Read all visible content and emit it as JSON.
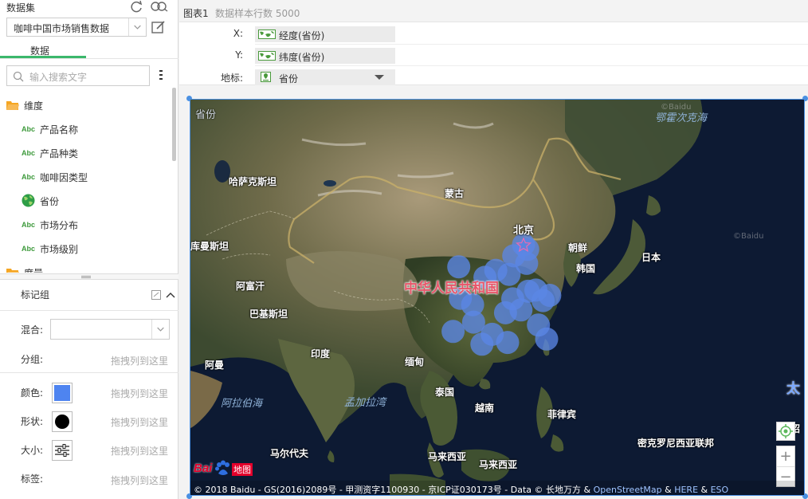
{
  "dataset": {
    "title": "数据集",
    "selected": "咖啡中国市场销售数据",
    "tab_data": "数据",
    "search_placeholder": "输入搜索文字"
  },
  "fields": {
    "dimension_group": "维度",
    "items": [
      {
        "type": "Abc",
        "label": "产品名称"
      },
      {
        "type": "Abc",
        "label": "产品种类"
      },
      {
        "type": "Abc",
        "label": "咖啡因类型"
      },
      {
        "type": "geo",
        "label": "省份"
      },
      {
        "type": "Abc",
        "label": "市场分布"
      },
      {
        "type": "Abc",
        "label": "市场级别"
      }
    ],
    "measure_group": "度量"
  },
  "marks": {
    "title": "标记组",
    "mix_label": "混合:",
    "group_label": "分组:",
    "color_label": "颜色:",
    "shape_label": "形状:",
    "size_label": "大小:",
    "tag_label": "标签:",
    "drop_hint": "拖拽列到这里",
    "color_value": "#4e84f0"
  },
  "chart": {
    "title": "图表1",
    "sample": "数据样本行数 5000",
    "x_label": "X:",
    "x_field": "经度(省份)",
    "y_label": "Y:",
    "y_field": "纬度(省份)",
    "geo_label": "地标:",
    "geo_field": "省份"
  },
  "map": {
    "corner_label": "省份",
    "labels": {
      "kazakh": "哈萨克斯坦",
      "mongolia": "蒙古",
      "beijing": "北京",
      "north_korea": "朝鲜",
      "south_korea": "韩国",
      "japan": "日本",
      "turkmen": "库曼斯坦",
      "afghan": "阿富汗",
      "pakistan": "巴基斯坦",
      "india": "印度",
      "myanmar": "缅甸",
      "oman": "阿曼",
      "thailand": "泰国",
      "vietnam": "越南",
      "philippines": "菲律宾",
      "maldives": "马尔代夫",
      "malaysia1": "马来西亚",
      "malaysia2": "马来西亚",
      "micronesia": "密克罗尼西亚联邦",
      "marshall": "马绍"
    },
    "seas": {
      "okhotsk": "鄂霍次克海",
      "arabian": "阿拉伯海",
      "bengal": "孟加拉湾"
    },
    "big_label": "中华人民共和国",
    "pacific": "太",
    "watermark": "©Baidu",
    "copyright": "© 2018 Baidu - GS(2016)2089号 - 甲测资字1100930 - 京ICP证030173号 - Data © 长地万方 & ",
    "osm": "OpenStreetMap",
    "amp1": " & ",
    "here": "HERE",
    "amp2": " & ",
    "eso": "ESO",
    "zoom_in": "+",
    "zoom_out": "−",
    "logo_text": "Bai",
    "logo_text2": "地图",
    "point_color": "#5b86e5",
    "bubbles": [
      {
        "lng": 116.4,
        "lat": 39.9
      },
      {
        "lng": 117.2,
        "lat": 39.1
      },
      {
        "lng": 114.5,
        "lat": 38.0
      },
      {
        "lng": 117.0,
        "lat": 36.7
      },
      {
        "lng": 113.6,
        "lat": 34.8
      },
      {
        "lng": 111.0,
        "lat": 35.5
      },
      {
        "lng": 108.9,
        "lat": 34.3
      },
      {
        "lng": 103.8,
        "lat": 36.1
      },
      {
        "lng": 118.8,
        "lat": 32.1
      },
      {
        "lng": 121.5,
        "lat": 31.2
      },
      {
        "lng": 117.3,
        "lat": 31.9
      },
      {
        "lng": 120.2,
        "lat": 30.3
      },
      {
        "lng": 114.3,
        "lat": 30.6
      },
      {
        "lng": 104.1,
        "lat": 30.7
      },
      {
        "lng": 106.5,
        "lat": 29.6
      },
      {
        "lng": 112.9,
        "lat": 28.2
      },
      {
        "lng": 115.9,
        "lat": 28.7
      },
      {
        "lng": 119.3,
        "lat": 26.1
      },
      {
        "lng": 102.7,
        "lat": 25.0
      },
      {
        "lng": 106.7,
        "lat": 26.6
      },
      {
        "lng": 113.3,
        "lat": 23.1
      },
      {
        "lng": 108.3,
        "lat": 22.8
      },
      {
        "lng": 110.3,
        "lat": 24.5
      },
      {
        "lng": 120.9,
        "lat": 23.7
      }
    ]
  }
}
